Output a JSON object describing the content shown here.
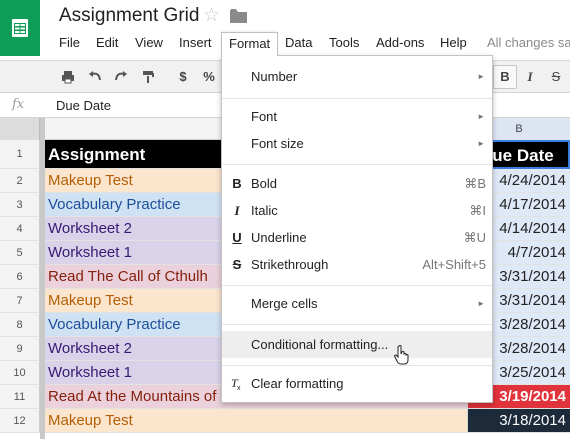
{
  "header": {
    "title": "Assignment Grid",
    "all_changes": "All changes sa"
  },
  "menubar": {
    "items": [
      "File",
      "Edit",
      "View",
      "Insert",
      "Format",
      "Data",
      "Tools",
      "Add-ons",
      "Help"
    ],
    "active": "Format"
  },
  "toolbar": {
    "currency": "$",
    "percent": "%",
    "bold": "B",
    "italic": "I",
    "strikethrough": "S"
  },
  "formula_bar": {
    "fx": "fx",
    "value": "Due Date"
  },
  "columns": {
    "b": "B"
  },
  "rows": [
    {
      "num": "1",
      "a": "Assignment",
      "b": "Due Date",
      "a_color": "#000000",
      "a_text": "#ffffff",
      "b_color": "#000000",
      "b_text": "#ffffff"
    },
    {
      "num": "2",
      "a": "Makeup Test",
      "b": "4/24/2014",
      "a_color": "#fce5cd",
      "a_text": "#b45f06",
      "b_color": "#dfe8f6",
      "b_text": "#222222"
    },
    {
      "num": "3",
      "a": "Vocabulary Practice",
      "b": "4/17/2014",
      "a_color": "#cfe2f3",
      "a_text": "#1f4e9a",
      "b_color": "#dfe8f6",
      "b_text": "#222222"
    },
    {
      "num": "4",
      "a": "Worksheet 2",
      "b": "4/14/2014",
      "a_color": "#d9d2e9",
      "a_text": "#351c75",
      "b_color": "#dfe8f6",
      "b_text": "#222222"
    },
    {
      "num": "5",
      "a": "Worksheet 1",
      "b": "4/7/2014",
      "a_color": "#d9d2e9",
      "a_text": "#351c75",
      "b_color": "#dfe8f6",
      "b_text": "#222222"
    },
    {
      "num": "6",
      "a": "Read The Call of Cthulh",
      "b": "3/31/2014",
      "a_color": "#ead1dc",
      "a_text": "#85200c",
      "b_color": "#dfe8f6",
      "b_text": "#222222"
    },
    {
      "num": "7",
      "a": "Makeup Test",
      "b": "3/31/2014",
      "a_color": "#fce5cd",
      "a_text": "#b45f06",
      "b_color": "#dfe8f6",
      "b_text": "#222222"
    },
    {
      "num": "8",
      "a": "Vocabulary Practice",
      "b": "3/28/2014",
      "a_color": "#cfe2f3",
      "a_text": "#1f4e9a",
      "b_color": "#dfe8f6",
      "b_text": "#222222"
    },
    {
      "num": "9",
      "a": "Worksheet 2",
      "b": "3/28/2014",
      "a_color": "#d9d2e9",
      "a_text": "#351c75",
      "b_color": "#dfe8f6",
      "b_text": "#222222"
    },
    {
      "num": "10",
      "a": "Worksheet 1",
      "b": "3/25/2014",
      "a_color": "#d9d2e9",
      "a_text": "#351c75",
      "b_color": "#dfe8f6",
      "b_text": "#222222"
    },
    {
      "num": "11",
      "a": "Read At the Mountains of Madness",
      "b": "3/19/2014",
      "a_color": "#ead1dc",
      "a_text": "#85200c",
      "b_color": "#e0333b",
      "b_text": "#ffffff"
    },
    {
      "num": "12",
      "a": "Makeup Test",
      "b": "3/18/2014",
      "a_color": "#fce5cd",
      "a_text": "#b45f06",
      "b_color": "#1c2a3a",
      "b_text": "#ffffff"
    }
  ],
  "format_menu": {
    "number": "Number",
    "font": "Font",
    "font_size": "Font size",
    "bold": {
      "label": "Bold",
      "icon": "B",
      "shortcut": "⌘B"
    },
    "italic": {
      "label": "Italic",
      "icon": "I",
      "shortcut": "⌘I"
    },
    "underline": {
      "label": "Underline",
      "icon": "U",
      "shortcut": "⌘U"
    },
    "strikethrough": {
      "label": "Strikethrough",
      "icon": "S",
      "shortcut": "Alt+Shift+5"
    },
    "merge_cells": "Merge cells",
    "conditional_formatting": "Conditional formatting...",
    "clear_formatting": "Clear formatting"
  },
  "colors": {
    "brand": "#0f9d58",
    "selection": "#3b7ddd"
  }
}
